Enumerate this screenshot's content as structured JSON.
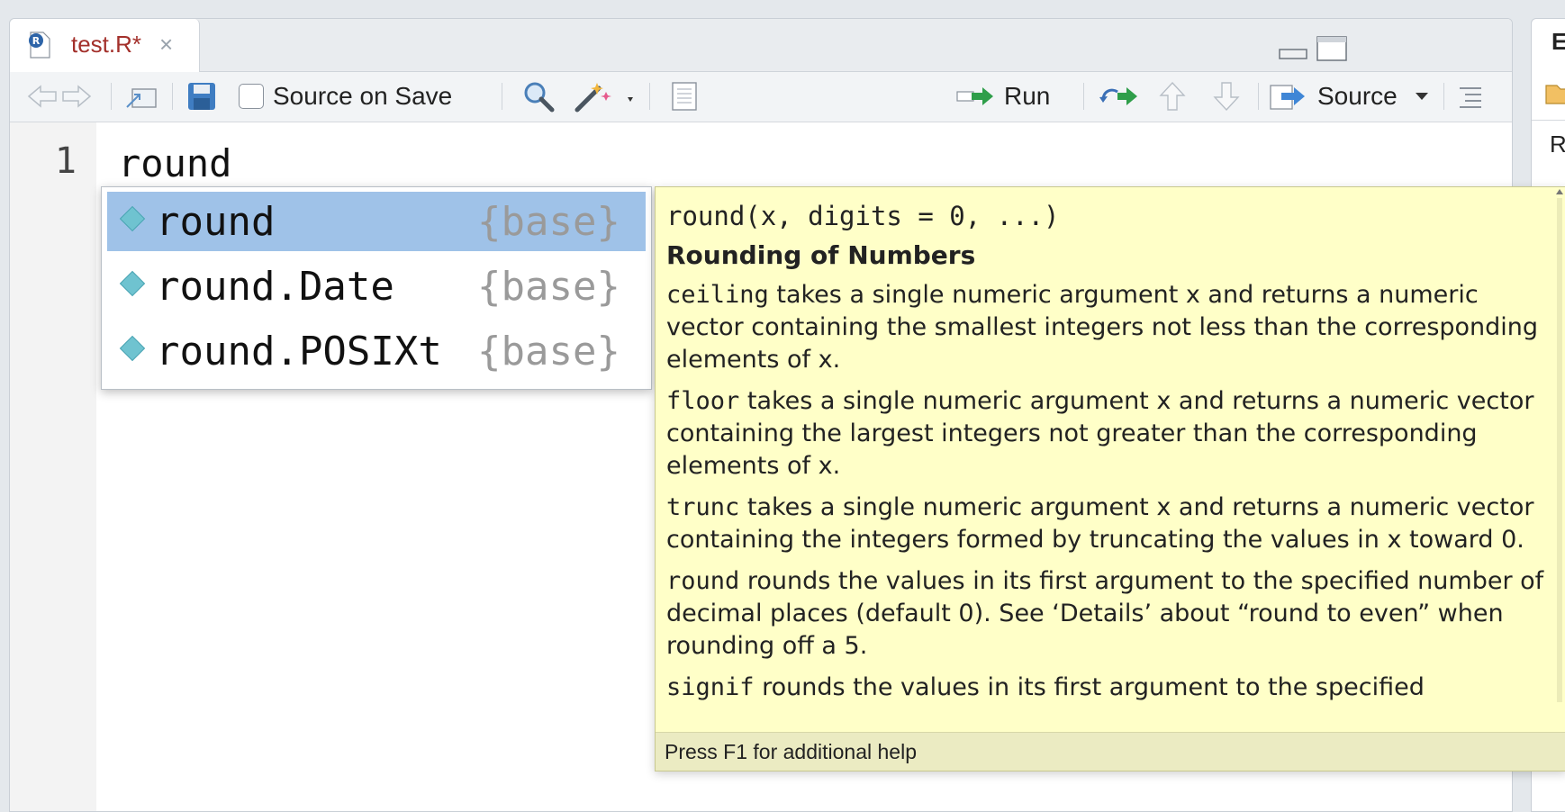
{
  "tab": {
    "filename": "test.R*",
    "close_glyph": "×"
  },
  "toolbar": {
    "source_on_save_label": "Source on Save",
    "run_label": "Run",
    "source_label": "Source"
  },
  "editor": {
    "line_numbers": [
      "1"
    ],
    "code_lines": [
      "round"
    ]
  },
  "completion": {
    "items": [
      {
        "name": "round",
        "pkg": "{base}",
        "selected": true
      },
      {
        "name": "round.Date",
        "pkg": "{base}",
        "selected": false
      },
      {
        "name": "round.POSIXt",
        "pkg": "{base}",
        "selected": false
      }
    ]
  },
  "help": {
    "signature": "round(x, digits = 0, ...)",
    "title": "Rounding of Numbers",
    "paragraphs": [
      {
        "code": "ceiling",
        "text": " takes a single numeric argument x and returns a numeric vector containing the smallest integers not less than the corresponding elements of x."
      },
      {
        "code": "floor",
        "text": " takes a single numeric argument x and returns a numeric vector containing the largest integers not greater than the corresponding elements of x."
      },
      {
        "code": "trunc",
        "text": " takes a single numeric argument x and returns a numeric vector containing the integers formed by truncating the values in x toward 0."
      },
      {
        "code": "round",
        "text": " rounds the values in its first argument to the specified number of decimal places (default 0). See ‘Details’ about “round to even” when rounding off a 5."
      },
      {
        "code": "signif",
        "text": " rounds the values in its first argument to the specified"
      }
    ],
    "footer": "Press F1 for additional help"
  },
  "right_pane": {
    "tab_initial": "E",
    "row_initial": "R"
  },
  "colors": {
    "tab_text": "#a3302b",
    "selection": "#9fc2e8",
    "help_bg": "#ffffc8"
  }
}
